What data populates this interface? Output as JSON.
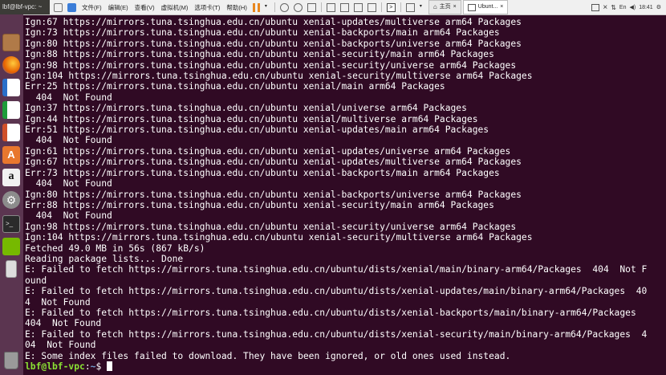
{
  "window": {
    "title": "lbf@lbf-vpc: ~"
  },
  "vm_toolbar": {
    "menus": [
      "文件(F)",
      "编辑(E)",
      "查看(V)",
      "虚拟机(M)",
      "选项卡(T)",
      "帮助(H)"
    ],
    "tabs": [
      {
        "label": "主页",
        "active": false
      },
      {
        "label": "Ubunt...",
        "active": true
      }
    ],
    "clock": "18:41"
  },
  "launcher": {
    "items": [
      "ubuntu-files-icon",
      "firefox-icon",
      "writer-icon",
      "calc-icon",
      "impress-icon",
      "software-center-icon",
      "amazon-icon",
      "settings-icon",
      "terminal-icon",
      "nvidia-icon",
      "usb-drive-icon",
      "trash-icon"
    ]
  },
  "terminal": {
    "lines": [
      "Ign:67 https://mirrors.tuna.tsinghua.edu.cn/ubuntu xenial-updates/multiverse arm64 Packages",
      "Ign:73 https://mirrors.tuna.tsinghua.edu.cn/ubuntu xenial-backports/main arm64 Packages",
      "Ign:80 https://mirrors.tuna.tsinghua.edu.cn/ubuntu xenial-backports/universe arm64 Packages",
      "Ign:88 https://mirrors.tuna.tsinghua.edu.cn/ubuntu xenial-security/main arm64 Packages",
      "Ign:98 https://mirrors.tuna.tsinghua.edu.cn/ubuntu xenial-security/universe arm64 Packages",
      "Ign:104 https://mirrors.tuna.tsinghua.edu.cn/ubuntu xenial-security/multiverse arm64 Packages",
      "Err:25 https://mirrors.tuna.tsinghua.edu.cn/ubuntu xenial/main arm64 Packages",
      "  404  Not Found",
      "Ign:37 https://mirrors.tuna.tsinghua.edu.cn/ubuntu xenial/universe arm64 Packages",
      "Ign:44 https://mirrors.tuna.tsinghua.edu.cn/ubuntu xenial/multiverse arm64 Packages",
      "Err:51 https://mirrors.tuna.tsinghua.edu.cn/ubuntu xenial-updates/main arm64 Packages",
      "  404  Not Found",
      "Ign:61 https://mirrors.tuna.tsinghua.edu.cn/ubuntu xenial-updates/universe arm64 Packages",
      "Ign:67 https://mirrors.tuna.tsinghua.edu.cn/ubuntu xenial-updates/multiverse arm64 Packages",
      "Err:73 https://mirrors.tuna.tsinghua.edu.cn/ubuntu xenial-backports/main arm64 Packages",
      "  404  Not Found",
      "Ign:80 https://mirrors.tuna.tsinghua.edu.cn/ubuntu xenial-backports/universe arm64 Packages",
      "Err:88 https://mirrors.tuna.tsinghua.edu.cn/ubuntu xenial-security/main arm64 Packages",
      "  404  Not Found",
      "Ign:98 https://mirrors.tuna.tsinghua.edu.cn/ubuntu xenial-security/universe arm64 Packages",
      "Ign:104 https://mirrors.tuna.tsinghua.edu.cn/ubuntu xenial-security/multiverse arm64 Packages",
      "Fetched 49.0 MB in 56s (867 kB/s)",
      "Reading package lists... Done",
      "E: Failed to fetch https://mirrors.tuna.tsinghua.edu.cn/ubuntu/dists/xenial/main/binary-arm64/Packages  404  Not F",
      "ound",
      "E: Failed to fetch https://mirrors.tuna.tsinghua.edu.cn/ubuntu/dists/xenial-updates/main/binary-arm64/Packages  40",
      "4  Not Found",
      "E: Failed to fetch https://mirrors.tuna.tsinghua.edu.cn/ubuntu/dists/xenial-backports/main/binary-arm64/Packages",
      "404  Not Found",
      "E: Failed to fetch https://mirrors.tuna.tsinghua.edu.cn/ubuntu/dists/xenial-security/main/binary-arm64/Packages  4",
      "04  Not Found",
      "E: Some index files failed to download. They have been ignored, or old ones used instead."
    ],
    "prompt_user": "lbf@lbf-vpc",
    "prompt_sep": ":",
    "prompt_path": "~",
    "prompt_symbol": "$ "
  },
  "colors": {
    "terminal_bg": "#300a24",
    "prompt_user": "#8ae234",
    "prompt_path": "#729fcf",
    "launcher_bg": "#5b3550"
  }
}
